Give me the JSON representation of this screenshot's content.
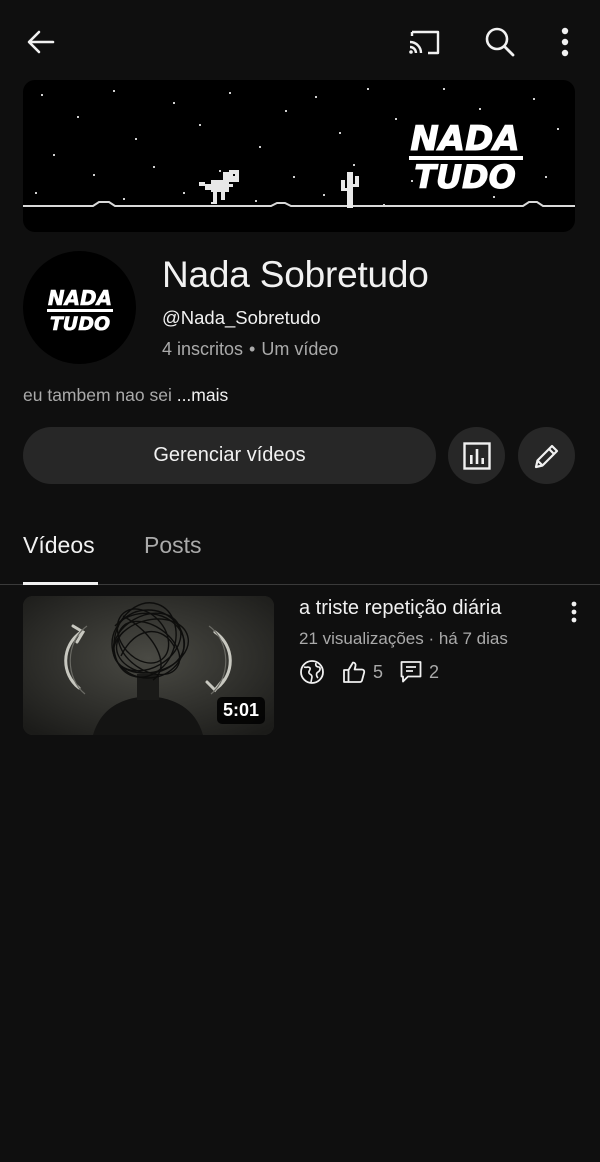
{
  "topbar": {
    "back_icon": "arrow-left-icon",
    "cast_icon": "cast-icon",
    "search_icon": "search-icon",
    "more_icon": "more-vert-icon"
  },
  "banner": {
    "logo_line1": "NADA",
    "logo_line2": "TUDO"
  },
  "avatar": {
    "logo_line1": "NADA",
    "logo_line2": "TUDO"
  },
  "channel": {
    "name": "Nada Sobretudo",
    "handle": "@Nada_Sobretudo",
    "subscribers": "4 inscritos",
    "separator": "•",
    "video_count": "Um vídeo",
    "description": "eu tambem nao sei ",
    "more_label": "...mais"
  },
  "actions": {
    "manage_label": "Gerenciar vídeos",
    "analytics_icon": "analytics-icon",
    "edit_icon": "edit-pencil-icon"
  },
  "tabs": [
    {
      "label": "Vídeos",
      "active": true
    },
    {
      "label": "Posts",
      "active": false
    }
  ],
  "videos": [
    {
      "title": "a triste repetição diária",
      "stats": "21 visualizações · há 7 dias",
      "duration": "5:01",
      "visibility_icon": "globe-public-icon",
      "likes": "5",
      "comments": "2"
    }
  ],
  "colors": {
    "background": "#0f0f0f",
    "surface": "#272727",
    "text_primary": "#f1f1f1",
    "text_secondary": "#aaaaaa"
  }
}
